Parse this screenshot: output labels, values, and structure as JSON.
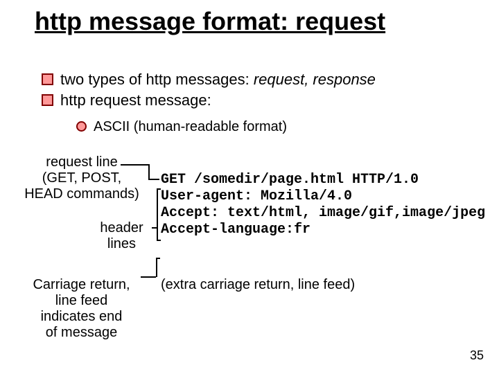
{
  "title": "http message format: request",
  "bullets": {
    "b1_pre": "two types of http messages: ",
    "b1_em": "request, response",
    "b2": "http request message:"
  },
  "sub": "ASCII (human-readable format)",
  "labels": {
    "request_line": "request line\n(GET, POST,\nHEAD commands)",
    "header_lines": "header\nlines",
    "carriage": "Carriage return,\nline feed\nindicates end\nof message"
  },
  "code": {
    "l1": "GET /somedir/page.html HTTP/1.0",
    "l2": "User-agent: Mozilla/4.0",
    "l3": "Accept: text/html, image/gif,image/jpeg",
    "l4": "Accept-language:fr"
  },
  "extra": "(extra carriage return, line feed)",
  "pagenum": "35"
}
